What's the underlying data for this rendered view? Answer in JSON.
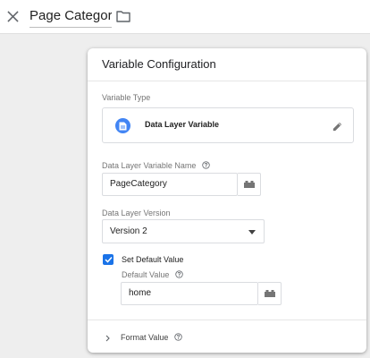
{
  "header": {
    "tag_name": "Page Category"
  },
  "card": {
    "title": "Variable Configuration",
    "variable_type": {
      "label": "Variable Type",
      "name": "Data Layer Variable"
    },
    "variable_name": {
      "label": "Data Layer Variable Name",
      "value": "PageCategory"
    },
    "version": {
      "label": "Data Layer Version",
      "selected": "Version 2"
    },
    "default_value": {
      "checkbox_label": "Set Default Value",
      "checked": true,
      "label": "Default Value",
      "value": "home"
    },
    "format_value": {
      "label": "Format Value"
    }
  },
  "colors": {
    "accent": "#1a73e8",
    "badge": "#4285f4",
    "icon": "#5f6368"
  },
  "icons": {
    "close": "close-icon",
    "folder": "folder-icon",
    "variable_type": "document-icon",
    "edit": "pencil-icon",
    "help": "help-circle-icon",
    "variable_picker": "brick-icon",
    "dropdown": "caret-down-icon",
    "check": "check-icon",
    "expand": "chevron-right-icon"
  }
}
